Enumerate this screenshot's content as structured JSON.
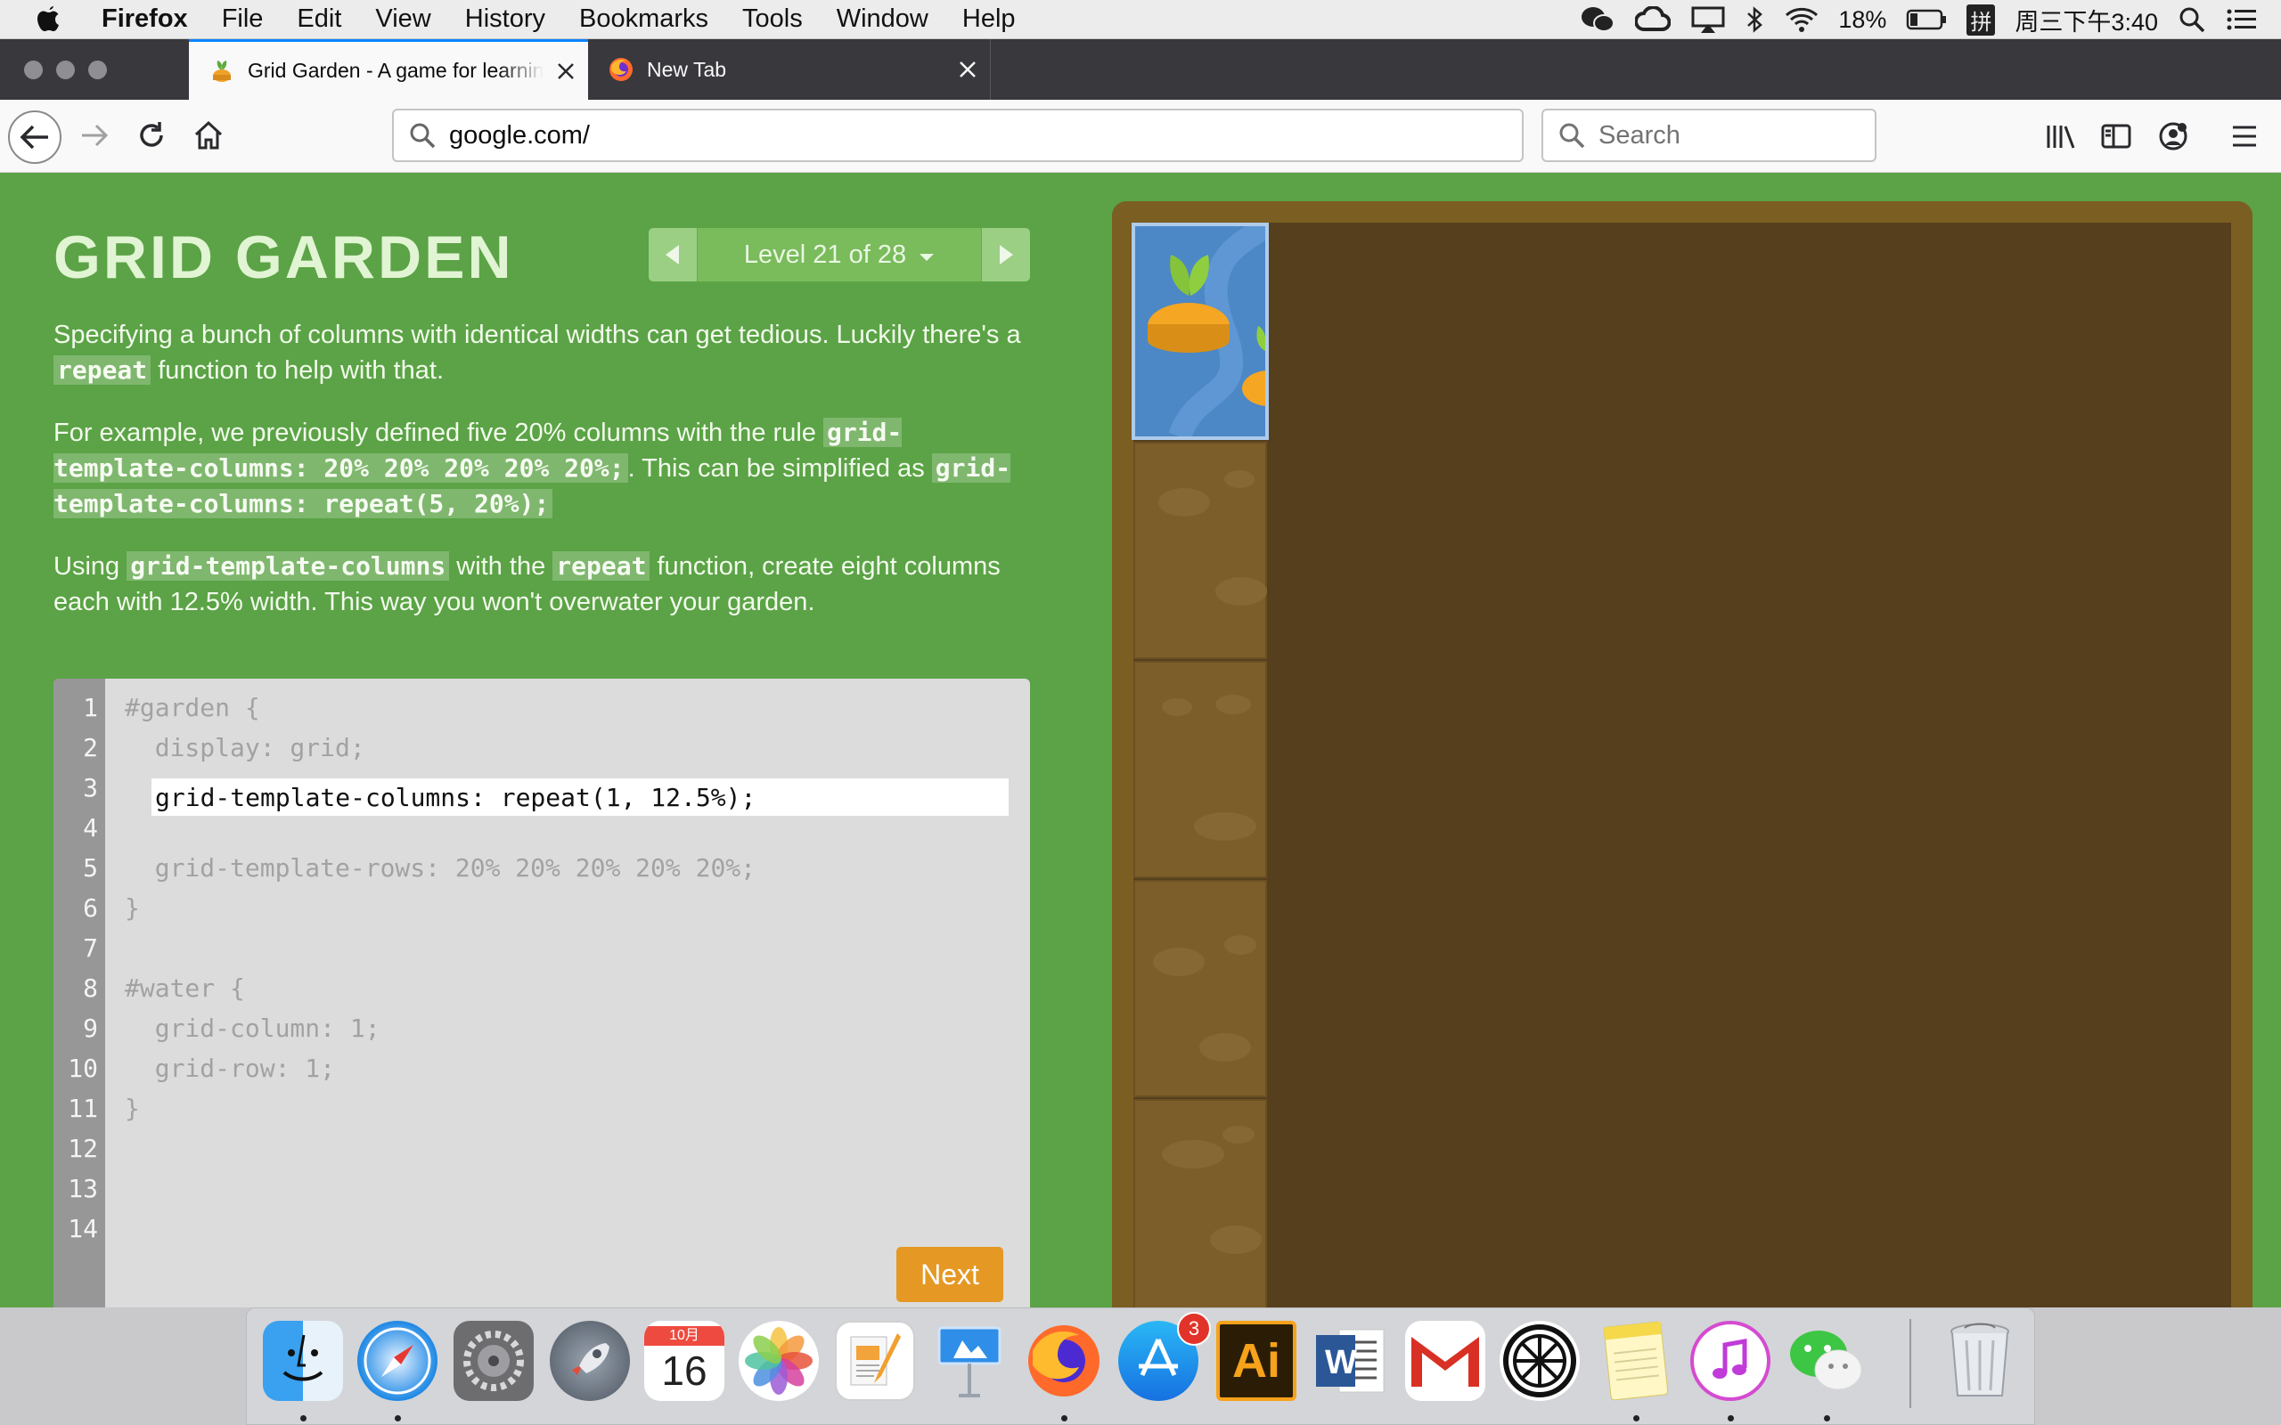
{
  "menubar": {
    "app": "Firefox",
    "items": [
      "File",
      "Edit",
      "View",
      "History",
      "Bookmarks",
      "Tools",
      "Window",
      "Help"
    ],
    "battery": "18%",
    "input_method": "拼",
    "clock": "周三下午3:40"
  },
  "tabs": {
    "active_title": "Grid Garden - A game for learning CSS grid",
    "inactive_title": "New Tab"
  },
  "urlbar": {
    "value": "google.com/"
  },
  "searchbar": {
    "placeholder": "Search"
  },
  "game": {
    "title": "GRID GARDEN",
    "level": "Level 21 of 28",
    "paragraphs": {
      "p1_a": "Specifying a bunch of columns with identical widths can get tedious. Luckily there's a ",
      "p1_code": "repeat",
      "p1_b": " function to help with that.",
      "p2_a": "For example, we previously defined five 20% columns with the rule ",
      "p2_code1": "grid-template-columns: 20% 20% 20% 20% 20%;",
      "p2_b": ". This can be simplified as ",
      "p2_code2": "grid-template-columns: repeat(5, 20%);",
      "p3_a": "Using ",
      "p3_code1": "grid-template-columns",
      "p3_b": " with the ",
      "p3_code2": "repeat",
      "p3_c": " function, create eight columns each with 12.5% width. This way you won't overwater your garden."
    },
    "editor": {
      "line_numbers": [
        "1",
        "2",
        "3",
        "4",
        "5",
        "6",
        "7",
        "8",
        "9",
        "10",
        "11",
        "12",
        "13",
        "14"
      ],
      "lines": {
        "l1": "#garden {",
        "l2": "  display: grid;",
        "l5": "  grid-template-rows: 20% 20% 20% 20% 20%;",
        "l6": "}",
        "l8": "#water {",
        "l9": "  grid-column: 1;",
        "l10": "  grid-row: 1;",
        "l11": "}"
      },
      "input_value": "grid-template-columns: repeat(1, 12.5%);"
    },
    "next_label": "Next"
  },
  "dock": {
    "apps": [
      "Finder",
      "Safari",
      "System Preferences",
      "Launchpad",
      "Calendar",
      "Photos",
      "Pages",
      "Keynote",
      "Firefox",
      "App Store",
      "Adobe Illustrator",
      "Microsoft Word",
      "Gmail",
      "Orange",
      "Notes",
      "iTunes",
      "WeChat",
      "Trash"
    ],
    "calendar_month": "10月",
    "calendar_day": "16",
    "appstore_badge": "3",
    "illustrator_label": "Ai",
    "word_label": "W"
  },
  "colors": {
    "page_green": "#5ba346",
    "garden_soil": "#553f1d",
    "water": "#4c87c6",
    "next_button": "#e59823",
    "firefox_tab_accent": "#0a84ff"
  }
}
